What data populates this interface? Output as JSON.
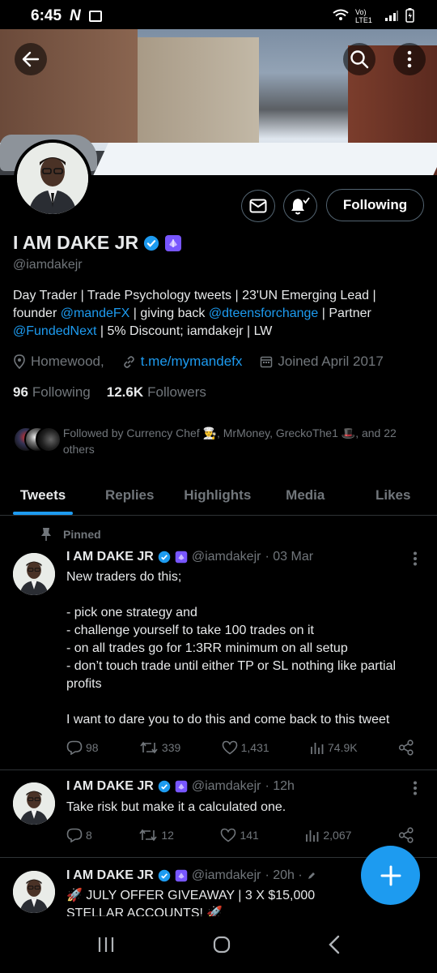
{
  "status_bar": {
    "time": "6:45",
    "network": "Vo) LTE1"
  },
  "profile": {
    "name": "I AM DAKE JR",
    "handle": "@iamdakejr",
    "bio_parts": {
      "p1": "Day Trader | Trade Psychology tweets | 23'UN Emerging Lead | founder ",
      "mention1": "@mandeFX",
      "p2": " | giving back ",
      "mention2": "@dteensforchange",
      "p3": " | Partner ",
      "mention3": "@FundedNext",
      "p4": " | 5% Discount; iamdakejr | LW"
    },
    "location": "Homewood,",
    "website": "t.me/mymandefx",
    "joined": "Joined April 2017",
    "following_count": "96",
    "following_label": "Following",
    "followers_count": "12.6K",
    "followers_label": "Followers",
    "followed_by": "Followed by Currency Chef 👨‍🍳, MrMoney, GreckoThe1 🎩, and 22 others",
    "following_button": "Following"
  },
  "tabs": [
    "Tweets",
    "Replies",
    "Highlights",
    "Media",
    "Likes"
  ],
  "pinned_label": "Pinned",
  "tweets": [
    {
      "name": "I AM DAKE JR",
      "handle": "@iamdakejr",
      "time": "· 03 Mar",
      "text": "New traders do this;\n\n- pick one strategy and\n- challenge yourself to take 100 trades on it\n- on all trades go for 1:3RR minimum on all setup\n- don’t touch trade until either TP or SL nothing like partial profits\n\nI want to dare you to do this and come back to this tweet",
      "replies": "98",
      "retweets": "339",
      "likes": "1,431",
      "views": "74.9K"
    },
    {
      "name": "I AM DAKE JR",
      "handle": "@iamdakejr",
      "time": "· 12h",
      "text": "Take risk but make it a calculated one.",
      "replies": "8",
      "retweets": "12",
      "likes": "141",
      "views": "2,067"
    },
    {
      "name": "I AM DAKE JR",
      "handle": "@iamdakejr",
      "time": "· 20h ·",
      "text": "🚀 JULY OFFER GIVEAWAY | 3 X $15,000 STELLAR ACCOUNTS! 🚀"
    }
  ],
  "colors": {
    "accent": "#1d9bf0",
    "muted": "#71767b",
    "text": "#e7e9ea",
    "bg": "#000000",
    "badge_purple": "#7856ff"
  },
  "icons": [
    "back-arrow-icon",
    "search-icon",
    "more-vert-icon",
    "mail-icon",
    "bell-check-icon",
    "verified-icon",
    "subscription-badge-icon",
    "location-icon",
    "link-icon",
    "calendar-icon",
    "pin-icon",
    "reply-icon",
    "retweet-icon",
    "like-icon",
    "views-icon",
    "share-icon",
    "compose-plus-icon"
  ]
}
